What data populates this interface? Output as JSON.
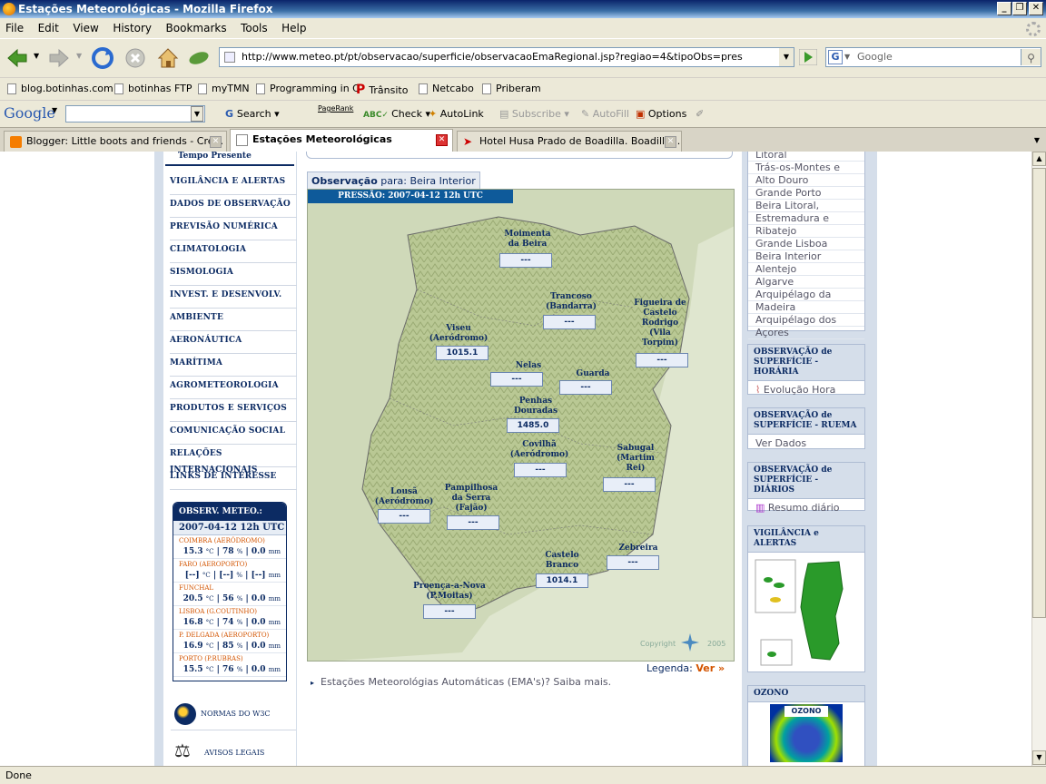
{
  "window": {
    "title": "Estações Meteorológicas - Mozilla Firefox"
  },
  "menu": [
    "File",
    "Edit",
    "View",
    "History",
    "Bookmarks",
    "Tools",
    "Help"
  ],
  "address": {
    "url": "http://www.meteo.pt/pt/observacao/superficie/observacaoEmaRegional.jsp?regiao=4&tipoObs=pres"
  },
  "search": {
    "placeholder": "Google"
  },
  "bookmarks": [
    "blog.botinhas.com",
    "botinhas FTP",
    "myTMN",
    "Programming in C",
    "Trânsito",
    "Netcabo",
    "Priberam"
  ],
  "google_toolbar": {
    "logo": "Google",
    "search": "Search",
    "pagerank": "PageRank",
    "check": "Check",
    "autolink": "AutoLink",
    "subscribe": "Subscribe",
    "autofill": "AutoFill",
    "options": "Options"
  },
  "tabs": [
    {
      "label": "Blogger: Little boots and friends - Cre...",
      "active": false
    },
    {
      "label": "Estações Meteorológicas",
      "active": true
    },
    {
      "label": "Hotel Husa Prado de Boadilla. Boadilla ...",
      "active": false
    }
  ],
  "status": "Done",
  "left_nav": {
    "current": "Tempo Presente",
    "items": [
      "VIGILÂNCIA E ALERTAS",
      "DADOS DE OBSERVAÇÃO",
      "PREVISÃO NUMÉRICA",
      "CLIMATOLOGIA",
      "SISMOLOGIA",
      "INVEST. E DESENVOLV.",
      "AMBIENTE",
      "AERONÁUTICA",
      "MARÍTIMA",
      "AGROMETEOROLOGIA",
      "PRODUTOS E SERVIÇOS",
      "COMUNICAÇÃO SOCIAL",
      "RELAÇÕES INTERNACIONAIS",
      "LINKS DE INTERESSE"
    ]
  },
  "obs_box": {
    "title": "OBSERV. METEO.:",
    "date": "2007-04-12 12h UTC",
    "stations": [
      {
        "name": "COIMBRA (AERÓDROMO)",
        "temp": "15.3",
        "hum": "78",
        "prec": "0.0"
      },
      {
        "name": "FARO (AEROPORTO)",
        "temp": "[--]",
        "hum": "[--]",
        "prec": "[--]"
      },
      {
        "name": "FUNCHAL",
        "temp": "20.5",
        "hum": "56",
        "prec": "0.0"
      },
      {
        "name": "LISBOA (G.COUTINHO)",
        "temp": "16.8",
        "hum": "74",
        "prec": "0.0"
      },
      {
        "name": "P. DELGADA (AEROPORTO)",
        "temp": "16.9",
        "hum": "85",
        "prec": "0.0"
      },
      {
        "name": "PORTO (P.RUBRAS)",
        "temp": "15.5",
        "hum": "76",
        "prec": "0.0"
      }
    ],
    "units": {
      "temp": "°C",
      "hum": "%",
      "prec": "mm"
    }
  },
  "footer_links": {
    "w3c": "NORMAS DO W3C",
    "legal": "AVISOS LEGAIS"
  },
  "main": {
    "obs_label": "Observação",
    "obs_for": "para:",
    "region": "Beira Interior",
    "banner": "PRESSÃO: 2007-04-12 12h UTC",
    "copyright": "Copyright",
    "copyright_year": "2005",
    "legend_label": "Legenda:",
    "legend_link": "Ver »",
    "info": "Estações Meteorológias Automáticas (EMA's)? Saiba mais."
  },
  "map_stations": [
    {
      "label": "Moimenta\nda Beira",
      "value": "---"
    },
    {
      "label": "Trancoso\n(Bandarra)",
      "value": "---"
    },
    {
      "label": "Figueira de\nCastelo\nRodrigo\n(Vila\nTorpim)",
      "value": "---"
    },
    {
      "label": "Viseu\n(Aeródromo)",
      "value": "1015.1"
    },
    {
      "label": "Nelas",
      "value": "---"
    },
    {
      "label": "Guarda",
      "value": "---"
    },
    {
      "label": "Penhas\nDouradas",
      "value": "1485.0"
    },
    {
      "label": "Covilhã\n(Aeródromo)",
      "value": "---"
    },
    {
      "label": "Sabugal\n(Martim\nRei)",
      "value": "---"
    },
    {
      "label": "Lousã\n(Aeródromo)",
      "value": "---"
    },
    {
      "label": "Pampilhosa\nda Serra\n(Fajão)",
      "value": "---"
    },
    {
      "label": "Zebreira",
      "value": "---"
    },
    {
      "label": "Castelo\nBranco",
      "value": "1014.1"
    },
    {
      "label": "Proença-a-Nova\n(P.Moitas)",
      "value": "---"
    }
  ],
  "right": {
    "regions": [
      "Litoral",
      "Trás-os-Montes e",
      "Alto Douro",
      "Grande Porto",
      "Beira Litoral,",
      "Estremadura e",
      "Ribatejo",
      "Grande Lisboa",
      "Beira Interior",
      "Alentejo",
      "Algarve",
      "Arquipélago da",
      "Madeira",
      "Arquipélago dos",
      "Açores"
    ],
    "box1": {
      "title": "OBSERVAÇÃO de SUPERFÍCIE - HORÁRIA",
      "link": "Evolução Hora"
    },
    "box2": {
      "title": "OBSERVAÇÃO de SUPERFÍCIE - RUEMA",
      "link": "Ver Dados"
    },
    "box3": {
      "title": "OBSERVAÇÃO de SUPERFÍCIE - DIÁRIOS",
      "link": "Resumo diário"
    },
    "box4": {
      "title": "VIGILÂNCIA e ALERTAS"
    },
    "box5": {
      "title": "OZONO",
      "image_label": "OZONO"
    }
  }
}
